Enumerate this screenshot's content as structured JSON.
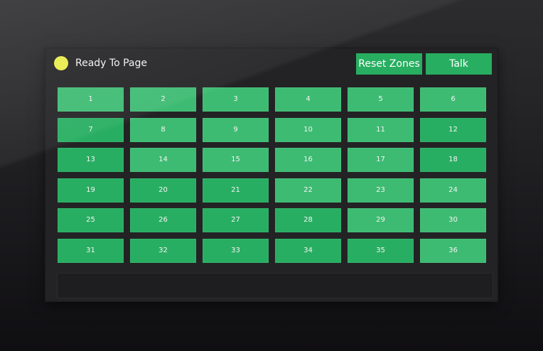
{
  "status": {
    "text": "Ready To Page",
    "indicator_color": "#e8ec4a"
  },
  "buttons": {
    "reset_label": "Reset Zones",
    "talk_label": "Talk"
  },
  "colors": {
    "zone": "#28ae62",
    "zone_highlight": "#3dbb72",
    "background": "#232325"
  },
  "zones": [
    "1",
    "2",
    "3",
    "4",
    "5",
    "6",
    "7",
    "8",
    "9",
    "10",
    "11",
    "12",
    "13",
    "14",
    "15",
    "16",
    "17",
    "18",
    "19",
    "20",
    "21",
    "22",
    "23",
    "24",
    "25",
    "26",
    "27",
    "28",
    "29",
    "30",
    "31",
    "32",
    "33",
    "34",
    "35",
    "36"
  ]
}
